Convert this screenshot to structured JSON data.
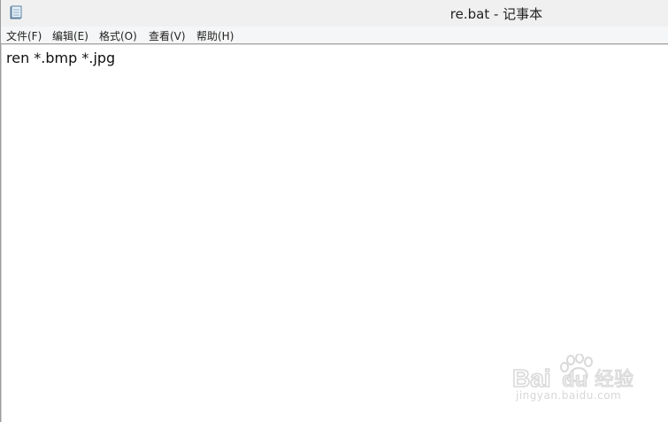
{
  "window": {
    "title": "re.bat - 记事本"
  },
  "menu": {
    "items": [
      {
        "label": "文件(F)"
      },
      {
        "label": "编辑(E)"
      },
      {
        "label": "格式(O)"
      },
      {
        "label": "查看(V)"
      },
      {
        "label": "帮助(H)"
      }
    ]
  },
  "editor": {
    "content": "ren *.bmp *.jpg"
  },
  "watermark": {
    "brand": "Baidu经验",
    "url": "jingyan.baidu.com"
  },
  "icons": {
    "app": "notepad-icon"
  },
  "colors": {
    "titlebar_bg": "#f0f0f0",
    "menubar_bg": "#f5f6f7",
    "editor_bg": "#ffffff",
    "watermark": "#d9d9d9"
  }
}
